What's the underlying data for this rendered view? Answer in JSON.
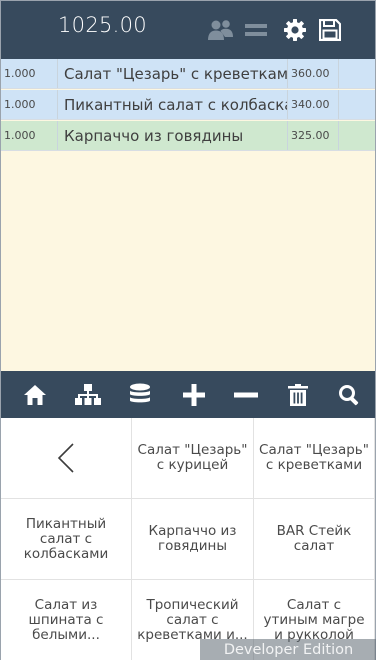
{
  "header": {
    "total": "1025.00",
    "icons": [
      "users-icon",
      "menu-lines-icon",
      "settings-gear-icon",
      "save-disk-icon"
    ]
  },
  "order": {
    "items": [
      {
        "qty": "1.000",
        "name": "Салат \"Цезарь\" с креветками",
        "price": "360.00",
        "state": "blue"
      },
      {
        "qty": "1.000",
        "name": "Пикантный салат с колбасками",
        "price": "340.00",
        "state": "blue"
      },
      {
        "qty": "1.000",
        "name": "Карпаччо из говядины",
        "price": "325.00",
        "state": "green"
      }
    ]
  },
  "toolbar": {
    "icons": [
      "home-icon",
      "hierarchy-icon",
      "database-icon",
      "plus-icon",
      "minus-icon",
      "trash-icon",
      "search-icon"
    ]
  },
  "menu": {
    "back_icon": "chevron-left-icon",
    "items": [
      "Салат \"Цезарь\" с курицей",
      "Салат \"Цезарь\" с креветками",
      "Пикантный салат с колбасками",
      "Карпаччо из говядины",
      "BAR Стейк салат",
      "Салат из шпината с белыми...",
      "Тропический салат с креветками и...",
      "Салат с утиным магре и рукколой"
    ]
  },
  "watermark": "Developer Edition",
  "colors": {
    "header_bg": "#374a5d",
    "list_bg": "#fdf7e1",
    "row_blue": "#cfe3f6",
    "row_green": "#cfe8cf",
    "icon_dim": "#7f8e9c",
    "icon_white": "#ffffff"
  }
}
